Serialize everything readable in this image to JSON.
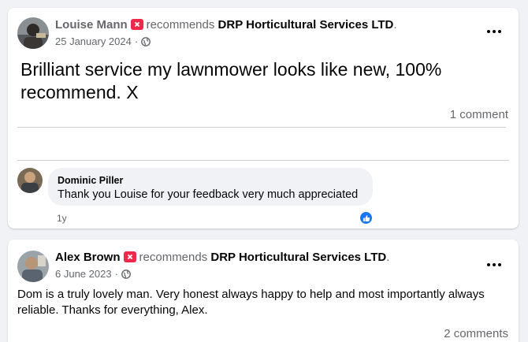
{
  "posts": [
    {
      "author": "Louise Mann",
      "recommends_text": "recommends",
      "page": "DRP Horticultural Services LTD",
      "date": "25 January 2024",
      "separator": "·",
      "body": "Brilliant service my lawnmower looks like new, 100% recommend. X",
      "comment_count": "1 comment",
      "comments": [
        {
          "author": "Dominic Piller",
          "text": "Thank you Louise for your feedback very much appreciated",
          "time": "1y",
          "reaction": "like-icon"
        }
      ]
    },
    {
      "author": "Alex Brown",
      "recommends_text": "recommends",
      "page": "DRP Horticultural Services LTD",
      "date": "6 June 2023",
      "separator": "·",
      "body": "Dom is a truly lovely man. Very honest always happy to help and most importantly always reliable. Thanks for everything, Alex.",
      "comment_count": "2 comments"
    }
  ],
  "icons": {
    "recommend": "recommend-badge-icon",
    "privacy": "globe-icon",
    "menu": "more-options-icon"
  },
  "colors": {
    "accent": "#1877f2",
    "recommend": "#f02849",
    "muted_text": "#65676b",
    "background": "#f0f2f5"
  }
}
